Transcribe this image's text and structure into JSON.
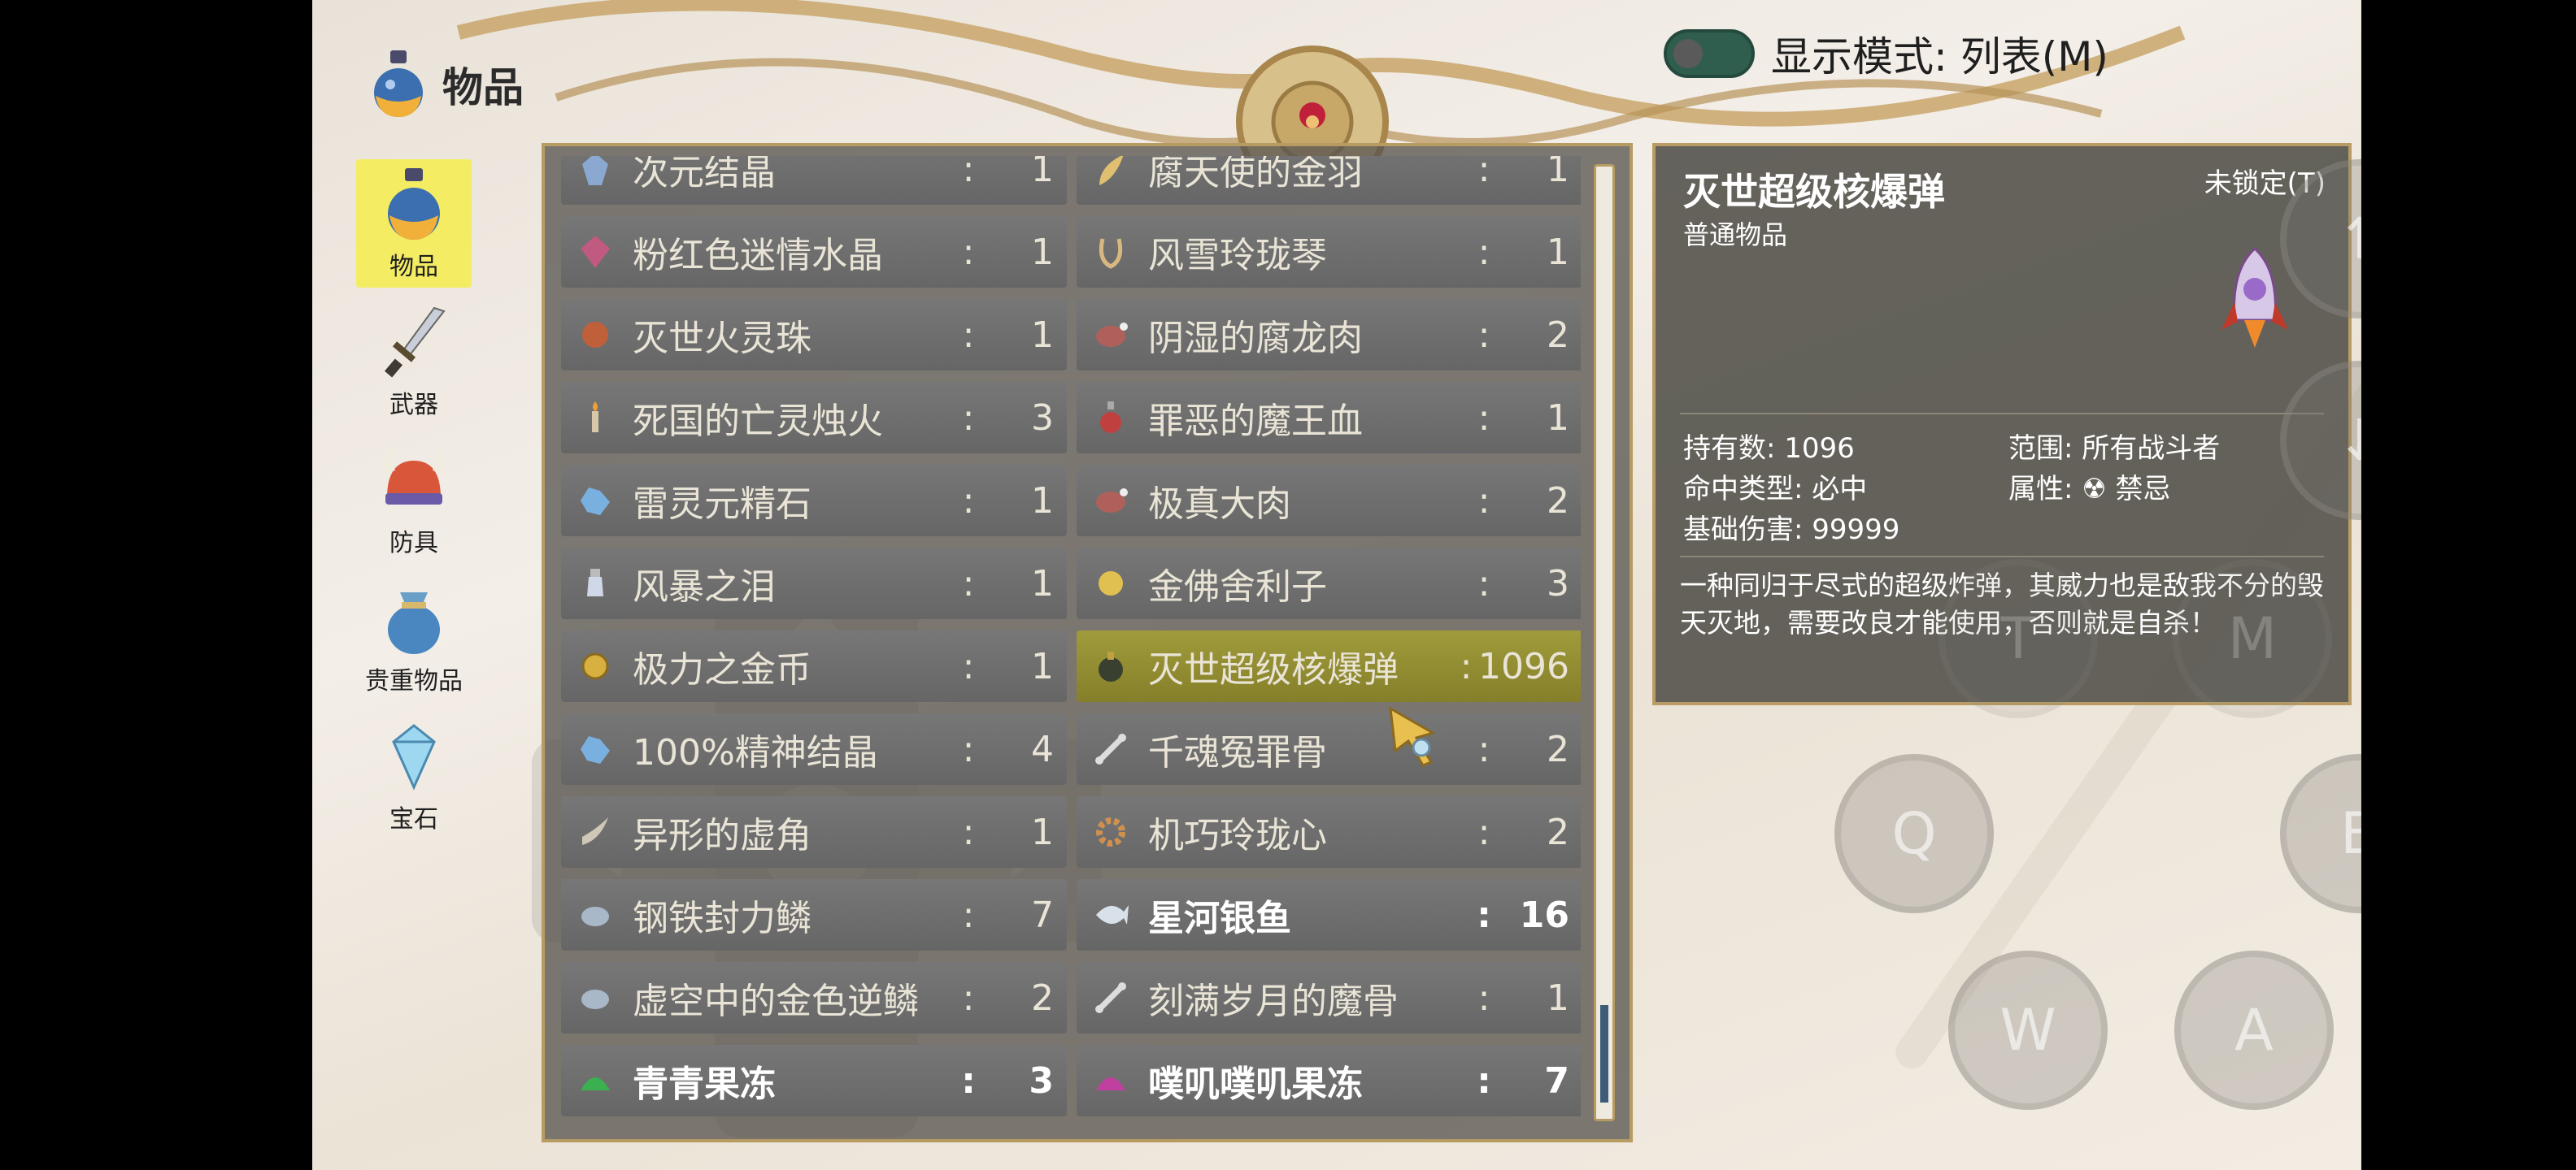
{
  "header": {
    "title": "物品",
    "mode_label": "显示模式: 列表(M)"
  },
  "categories": [
    {
      "label": "物品",
      "icon": "potion-icon",
      "active": true
    },
    {
      "label": "武器",
      "icon": "sword-icon",
      "active": false
    },
    {
      "label": "防具",
      "icon": "helmet-icon",
      "active": false
    },
    {
      "label": "贵重物品",
      "icon": "pouch-icon",
      "active": false
    },
    {
      "label": "宝石",
      "icon": "gem-icon",
      "active": false
    }
  ],
  "items": [
    [
      {
        "name": "次元结晶",
        "qty": "1",
        "icon": "crystal-icon"
      },
      {
        "name": "腐天使的金羽",
        "qty": "1",
        "icon": "feather-icon"
      }
    ],
    [
      {
        "name": "粉红色迷情水晶",
        "qty": "1",
        "icon": "pink-crystal-icon"
      },
      {
        "name": "风雪玲珑琴",
        "qty": "1",
        "icon": "lyre-icon"
      }
    ],
    [
      {
        "name": "灭世火灵珠",
        "qty": "1",
        "icon": "orb-icon"
      },
      {
        "name": "阴湿的腐龙肉",
        "qty": "2",
        "icon": "meat-icon"
      }
    ],
    [
      {
        "name": "死国的亡灵烛火",
        "qty": "3",
        "icon": "candle-icon"
      },
      {
        "name": "罪恶的魔王血",
        "qty": "1",
        "icon": "flask-icon"
      }
    ],
    [
      {
        "name": "雷灵元精石",
        "qty": "1",
        "icon": "ore-icon"
      },
      {
        "name": "极真大肉",
        "qty": "2",
        "icon": "meat-icon"
      }
    ],
    [
      {
        "name": "风暴之泪",
        "qty": "1",
        "icon": "vial-icon"
      },
      {
        "name": "金佛舍利子",
        "qty": "3",
        "icon": "gold-orb-icon"
      }
    ],
    [
      {
        "name": "极力之金币",
        "qty": "1",
        "icon": "coin-icon"
      },
      {
        "name": "灭世超级核爆弹",
        "qty": "1096",
        "icon": "bomb-icon",
        "selected": true
      }
    ],
    [
      {
        "name": "100%精神结晶",
        "qty": "4",
        "icon": "ore-icon"
      },
      {
        "name": "千魂冤罪骨",
        "qty": "2",
        "icon": "bone-icon"
      }
    ],
    [
      {
        "name": "异形的虚角",
        "qty": "1",
        "icon": "horn-icon"
      },
      {
        "name": "机巧玲珑心",
        "qty": "2",
        "icon": "gear-icon"
      }
    ],
    [
      {
        "name": "钢铁封力鳞",
        "qty": "7",
        "icon": "scale-icon"
      },
      {
        "name": "星河银鱼",
        "qty": "16",
        "icon": "fish-icon",
        "bold": true
      }
    ],
    [
      {
        "name": "虚空中的金色逆鳞",
        "qty": "2",
        "icon": "scale-icon"
      },
      {
        "name": "刻满岁月的魔骨",
        "qty": "1",
        "icon": "bone-icon"
      }
    ],
    [
      {
        "name": "青青果冻",
        "qty": "3",
        "icon": "green-jelly-icon",
        "bold": true
      },
      {
        "name": "噗叽噗叽果冻",
        "qty": "7",
        "icon": "pink-jelly-icon",
        "bold": true
      }
    ]
  ],
  "separator": ":",
  "detail": {
    "name": "灭世超级核爆弹",
    "lock": "未锁定(T)",
    "type": "普通物品",
    "stats": {
      "count": "持有数: 1096",
      "range": "范围: 所有战斗者",
      "hit": "命中类型: 必中",
      "attr": "属性: ☢ 禁忌",
      "damage": "基础伤害: 99999"
    },
    "description": "一种同归于尽式的超级炸弹，其威力也是敌我不分的毁天灭地，需要改良才能使用，否则就是自杀！"
  },
  "controls": {
    "up": "↑",
    "down": "↓",
    "q": "Q",
    "b": "B",
    "w": "W",
    "a": "A",
    "t": "T",
    "m": "M"
  },
  "colors": {
    "active_category": "#f4ed63",
    "selected_row": "#9a9434",
    "toggle": "#2f5e4e"
  }
}
